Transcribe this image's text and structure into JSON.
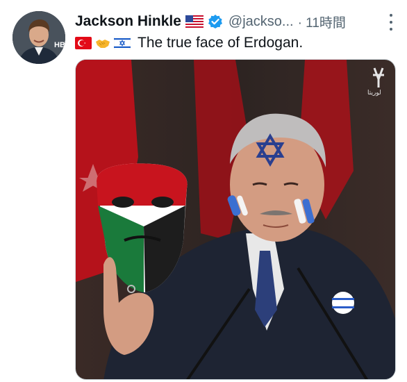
{
  "tweet": {
    "author": {
      "display_name": "Jackson Hinkle",
      "handle": "@jackso...",
      "flag": "us-flag",
      "verified": true,
      "avatar_overlay": "HB"
    },
    "timestamp": "· 11時間",
    "emojis": [
      "turkey-flag",
      "handshake",
      "israel-flag"
    ],
    "text": "The true face of Erdogan.",
    "media": {
      "description": "image",
      "watermark": "لوريتا"
    }
  },
  "colors": {
    "verified": "#1d9bf0",
    "muted_text": "#536471",
    "text": "#0f1419"
  }
}
